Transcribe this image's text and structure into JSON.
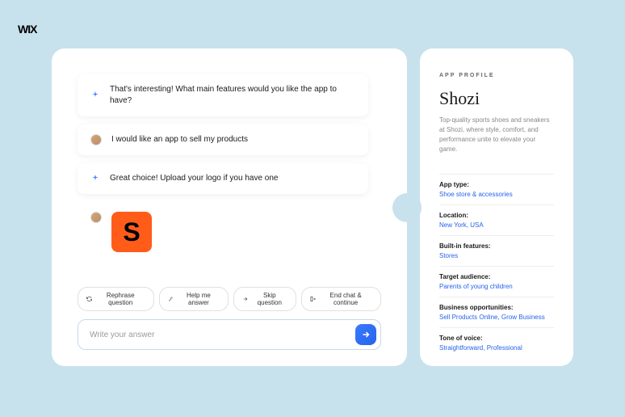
{
  "logo": "WIX",
  "chat": {
    "messages": [
      {
        "type": "ai",
        "text": "That's interesting! What main features would you like the app to have?"
      },
      {
        "type": "user",
        "text": "I would like an app to sell my products"
      },
      {
        "type": "ai",
        "text": "Great choice!  Upload your logo if you have one"
      }
    ],
    "uploaded_logo_letter": "S"
  },
  "actions": {
    "rephrase": "Rephrase question",
    "help": "Help me answer",
    "skip": "Skip question",
    "end": "End chat & continue"
  },
  "input": {
    "placeholder": "Write your answer"
  },
  "profile": {
    "section_label": "APP PROFILE",
    "title": "Shozi",
    "description": "Top-quality sports shoes and sneakers at Shozi, where style, comfort, and performance unite to elevate your game.",
    "fields": [
      {
        "label": "App type:",
        "value": "Shoe store & accessories"
      },
      {
        "label": "Location:",
        "value": "New York, USA"
      },
      {
        "label": "Built-in features:",
        "value": "Stores"
      },
      {
        "label": "Target audience:",
        "value": "Parents of young children"
      },
      {
        "label": "Business opportunities:",
        "value": "Sell Products Online, Grow Business"
      },
      {
        "label": "Tone of voice:",
        "value": "Straightforward, Professional"
      }
    ]
  }
}
